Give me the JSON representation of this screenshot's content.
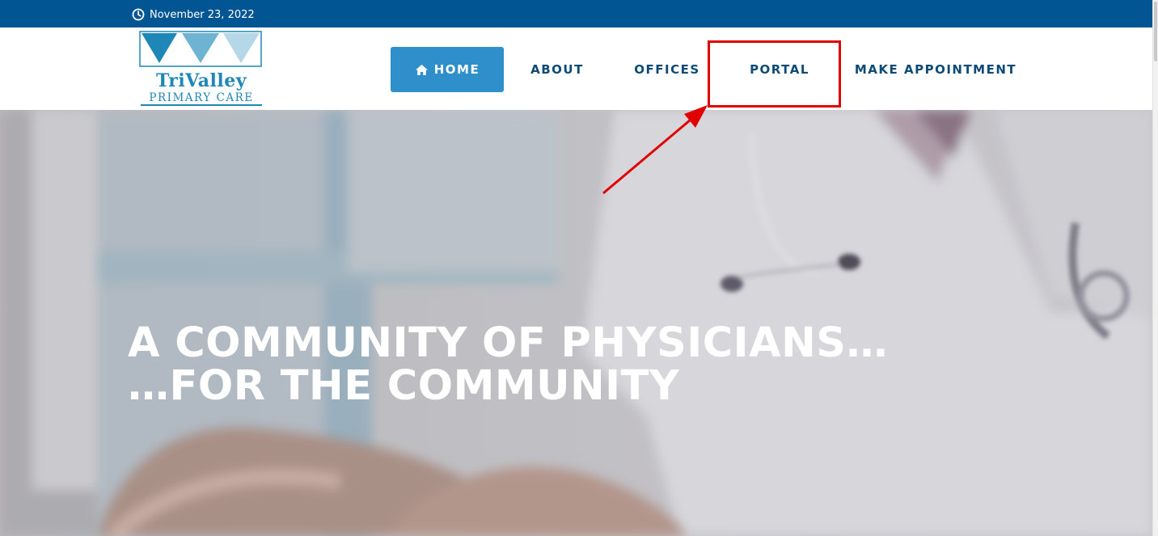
{
  "topbar": {
    "date": "November 23, 2022",
    "icon": "clock-icon"
  },
  "logo": {
    "title": "TriValley",
    "subtitle": "PRIMARY CARE",
    "colors": [
      "#1f87b7",
      "#6fb3d2",
      "#b5d8e8"
    ]
  },
  "nav": {
    "items": [
      {
        "label": "HOME",
        "icon": "home-icon",
        "active": true
      },
      {
        "label": "ABOUT"
      },
      {
        "label": "OFFICES"
      },
      {
        "label": "PORTAL",
        "highlighted": true
      },
      {
        "label": "MAKE APPOINTMENT"
      }
    ]
  },
  "hero": {
    "line1": "A COMMUNITY OF PHYSICIANS…",
    "line2": "…FOR THE COMMUNITY"
  },
  "colors": {
    "topbar": "#005592",
    "nav_text": "#0d4a76",
    "nav_active_bg": "#2f8fcb",
    "annotation": "#e00000"
  }
}
